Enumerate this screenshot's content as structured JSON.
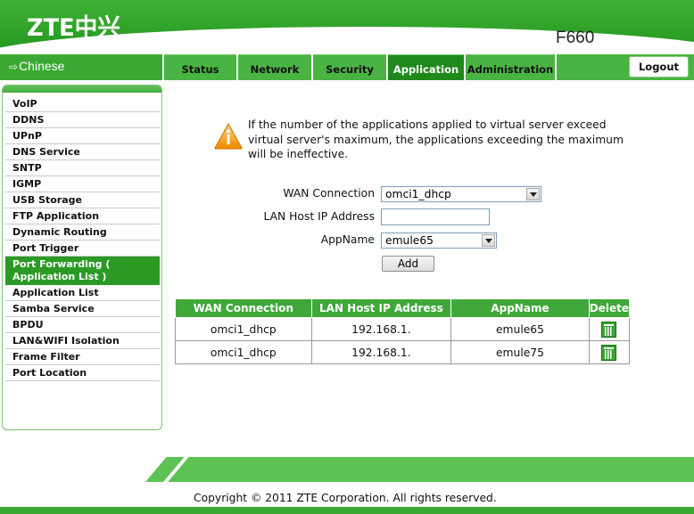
{
  "header": {
    "logo": "ZTE中兴",
    "model": "F660"
  },
  "nav": {
    "language": "Chinese",
    "tabs": [
      {
        "label": "Status",
        "active": false
      },
      {
        "label": "Network",
        "active": false
      },
      {
        "label": "Security",
        "active": false
      },
      {
        "label": "Application",
        "active": true
      },
      {
        "label": "Administration",
        "active": false
      }
    ],
    "logout": "Logout"
  },
  "sidebar": {
    "items": [
      {
        "label": "VoIP"
      },
      {
        "label": "DDNS"
      },
      {
        "label": "UPnP"
      },
      {
        "label": "DNS Service"
      },
      {
        "label": "SNTP"
      },
      {
        "label": "IGMP"
      },
      {
        "label": "USB Storage"
      },
      {
        "label": "FTP Application"
      },
      {
        "label": "Dynamic Routing"
      },
      {
        "label": "Port Trigger"
      },
      {
        "label": "Port Forwarding ( Application List )",
        "active": true
      },
      {
        "label": "Application List"
      },
      {
        "label": "Samba Service"
      },
      {
        "label": "BPDU"
      },
      {
        "label": "LAN&WIFI Isolation"
      },
      {
        "label": "Frame Filter"
      },
      {
        "label": "Port Location"
      }
    ]
  },
  "main": {
    "warning_text": "If the number of the applications applied to virtual server exceed virtual server's maximum, the applications exceeding the maximum will be ineffective.",
    "form": {
      "wan_label": "WAN Connection",
      "wan_value": "omci1_dhcp",
      "lan_label": "LAN Host IP Address",
      "lan_value": "",
      "app_label": "AppName",
      "app_value": "emule65",
      "add_label": "Add"
    },
    "table": {
      "headers": [
        "WAN Connection",
        "LAN Host IP Address",
        "AppName",
        "Delete"
      ],
      "rows": [
        {
          "wan": "omci1_dhcp",
          "ip": "192.168.1.",
          "app": "emule65"
        },
        {
          "wan": "omci1_dhcp",
          "ip": "192.168.1.",
          "app": "emule75"
        }
      ]
    }
  },
  "footer": {
    "copyright": "Copyright © 2011 ZTE Corporation. All rights reserved."
  },
  "colors": {
    "brand_green": "#3aa833",
    "active_tab": "#1f8a1b"
  }
}
